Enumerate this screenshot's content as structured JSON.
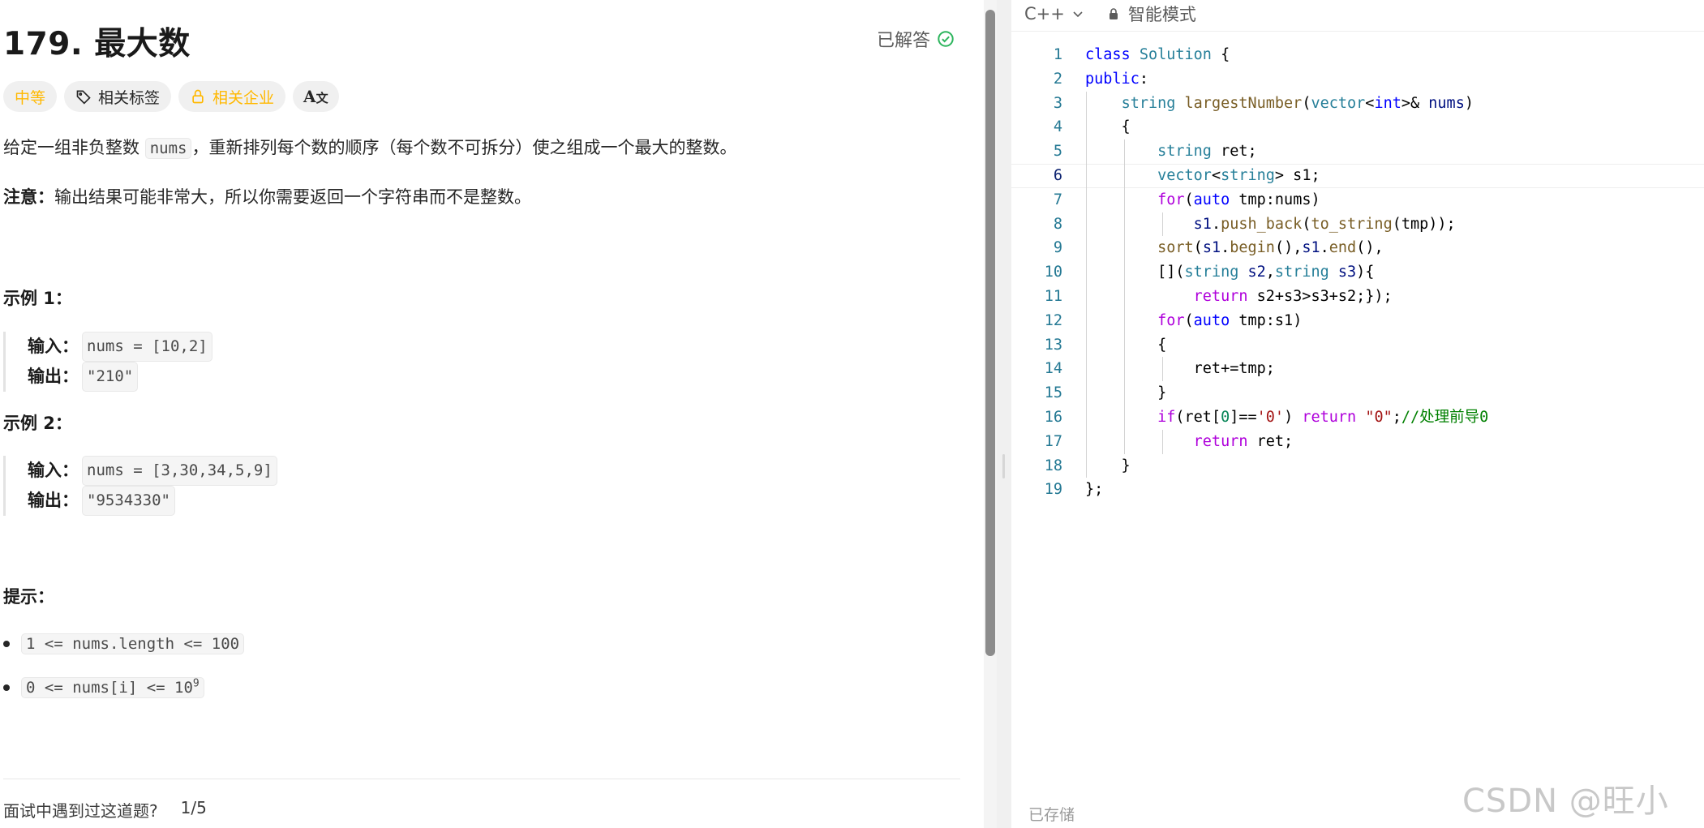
{
  "problem": {
    "title": "179. 最大数",
    "status": "已解答",
    "tags": {
      "difficulty": "中等",
      "related_tags": "相关标签",
      "related_companies": "相关企业",
      "translate": "A文"
    },
    "desc_prefix": "给定一组非负整数",
    "desc_code": "nums",
    "desc_suffix": "，重新排列每个数的顺序（每个数不可拆分）使之组成一个最大的整数。",
    "note_label": "注意：",
    "note_text": "输出结果可能非常大，所以你需要返回一个字符串而不是整数。",
    "examples": [
      {
        "title": "示例 1：",
        "input_label": "输入：",
        "input_value": "nums = [10,2]",
        "output_label": "输出：",
        "output_value": "\"210\""
      },
      {
        "title": "示例 2：",
        "input_label": "输入：",
        "input_value": "nums = [3,30,34,5,9]",
        "output_label": "输出：",
        "output_value": "\"9534330\""
      }
    ],
    "hints_title": "提示：",
    "constraints": [
      {
        "text": "1 <= nums.length <= 100"
      },
      {
        "text": "0 <= nums[i] <= 10",
        "sup": "9"
      }
    ],
    "interview_question": "面试中遇到过这道题?",
    "interview_count": "1/5"
  },
  "editor": {
    "language": "C++",
    "mode": "智能模式",
    "saved_status": "已存储",
    "active_line": 6,
    "lines": [
      "1",
      "2",
      "3",
      "4",
      "5",
      "6",
      "7",
      "8",
      "9",
      "10",
      "11",
      "12",
      "13",
      "14",
      "15",
      "16",
      "17",
      "18",
      "19"
    ]
  },
  "watermark": "CSDN @旺小仔."
}
